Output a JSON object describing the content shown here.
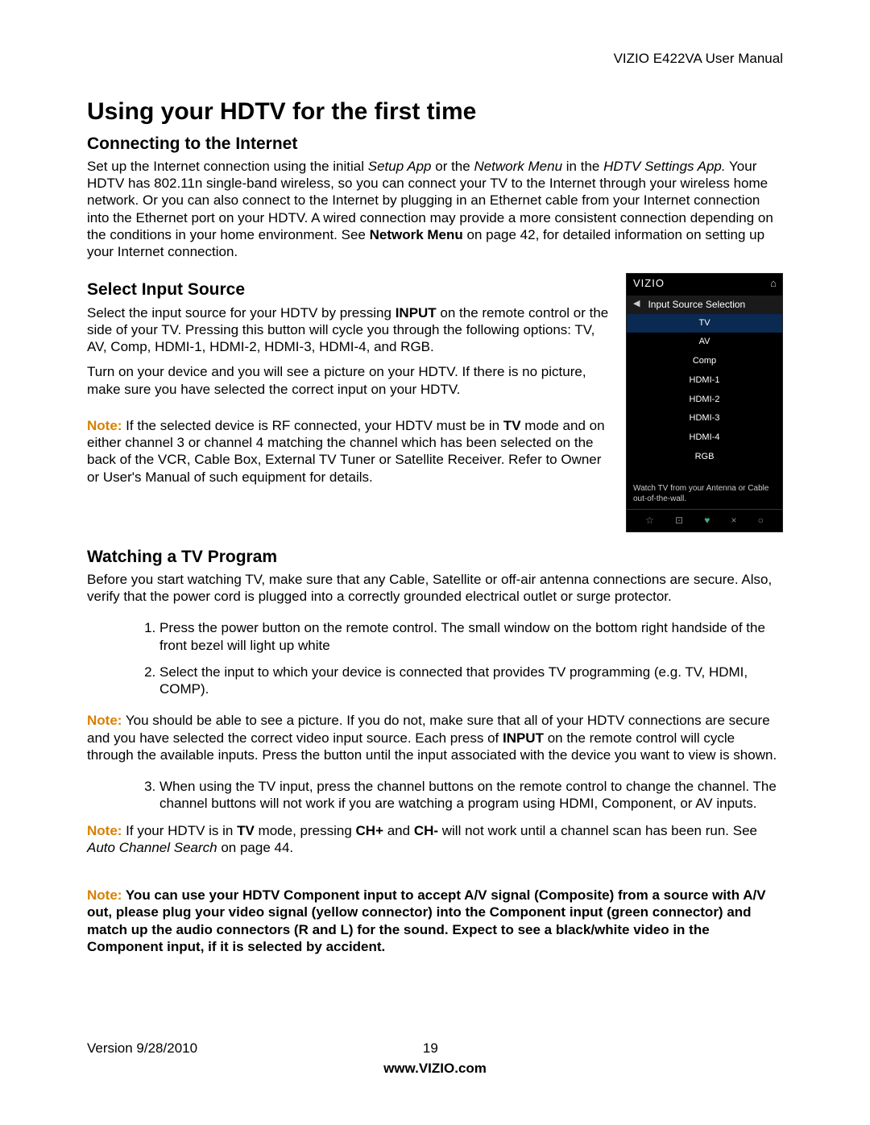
{
  "header": {
    "product": "VIZIO E422VA User Manual"
  },
  "h1": "Using your HDTV for the first time",
  "sec_internet": {
    "title": "Connecting to the Internet",
    "p1a": "Set up the Internet connection using the initial ",
    "p1b": "Setup App",
    "p1c": " or the ",
    "p1d": "Network Menu",
    "p1e": " in the ",
    "p1f": "HDTV Settings App.",
    "p1g": " Your HDTV has 802.11n single-band wireless, so you can connect your TV to the Internet through your wireless home network. Or you can also connect to the Internet by plugging in an Ethernet cable from your Internet connection into the Ethernet port on your HDTV. A wired connection may provide a more consistent connection depending on the conditions in your home environment. See ",
    "p1h": "Network Menu",
    "p1i": " on page 42, for detailed information on setting up your Internet connection."
  },
  "sec_input": {
    "title": "Select Input Source",
    "p1a": "Select the input source for your HDTV by pressing ",
    "p1b": "INPUT",
    "p1c": " on the remote control or the side of your TV.  Pressing this button will cycle you through the following options: TV, AV, Comp, HDMI-1, HDMI-2, HDMI-3, HDMI-4, and RGB.",
    "p2": "Turn on your device and you will see a picture on your HDTV. If there is no picture, make sure you have selected the correct input on your HDTV.",
    "note_label": "Note:",
    "note_a": " If the selected device is RF connected, your HDTV must be in ",
    "note_b": "TV",
    "note_c": " mode and on either channel 3 or channel 4 matching the channel which has been selected on the back of the VCR, Cable Box, External TV Tuner or Satellite Receiver. Refer to Owner or User's Manual of such equipment for details."
  },
  "osd": {
    "brand": "VIZIO",
    "title": "Input Source Selection",
    "items": [
      "TV",
      "AV",
      "Comp",
      "HDMI-1",
      "HDMI-2",
      "HDMI-3",
      "HDMI-4",
      "RGB"
    ],
    "selected": 0,
    "hint": "Watch TV from your Antenna or Cable out-of-the-wall.",
    "icons": [
      "☆",
      "⊡",
      "♥",
      "×",
      "○"
    ]
  },
  "sec_watch": {
    "title": "Watching a TV Program",
    "p1": "Before you start watching TV, make sure that any Cable, Satellite or off-air antenna connections are secure. Also, verify that the power cord is plugged into a correctly grounded electrical outlet or surge protector.",
    "ol1": [
      "Press the power button on the remote control. The small window on the bottom right handside of the front bezel will light up white",
      "Select the input to which your device is connected that provides TV programming (e.g. TV, HDMI, COMP)."
    ],
    "note2_label": "Note:",
    "note2_a": " You should be able to see a picture.  If you do not, make sure that all of your HDTV connections are secure and you have selected the correct video input source. Each press of ",
    "note2_b": "INPUT",
    "note2_c": " on the remote control will cycle through the available inputs. Press the button until the input associated with the device you want to view is shown.",
    "ol2_start": 3,
    "ol2": [
      "When using the TV input, press the channel buttons on the remote control to change the channel. The channel buttons will not work if you are watching a program using HDMI, Component, or AV inputs."
    ],
    "note3_label": "Note:",
    "note3_a": " If your HDTV is in ",
    "note3_b": "TV",
    "note3_c": " mode, pressing ",
    "note3_d": "CH+",
    "note3_e": " and ",
    "note3_f": "CH-",
    "note3_g": " will not work until a channel scan has been run. See ",
    "note3_h": "Auto Channel Search",
    "note3_i": " on page 44.",
    "note4_label": "Note:  ",
    "note4": "You can use your HDTV Component input to accept A/V signal (Composite) from a source with A/V out, please plug your video signal (yellow connector) into the Component input (green connector) and match up the audio connectors (R and L) for the sound. Expect to see a black/white video in the Component input, if it is selected by accident."
  },
  "footer": {
    "version": "Version 9/28/2010",
    "page": "19",
    "url": "www.VIZIO.com"
  }
}
